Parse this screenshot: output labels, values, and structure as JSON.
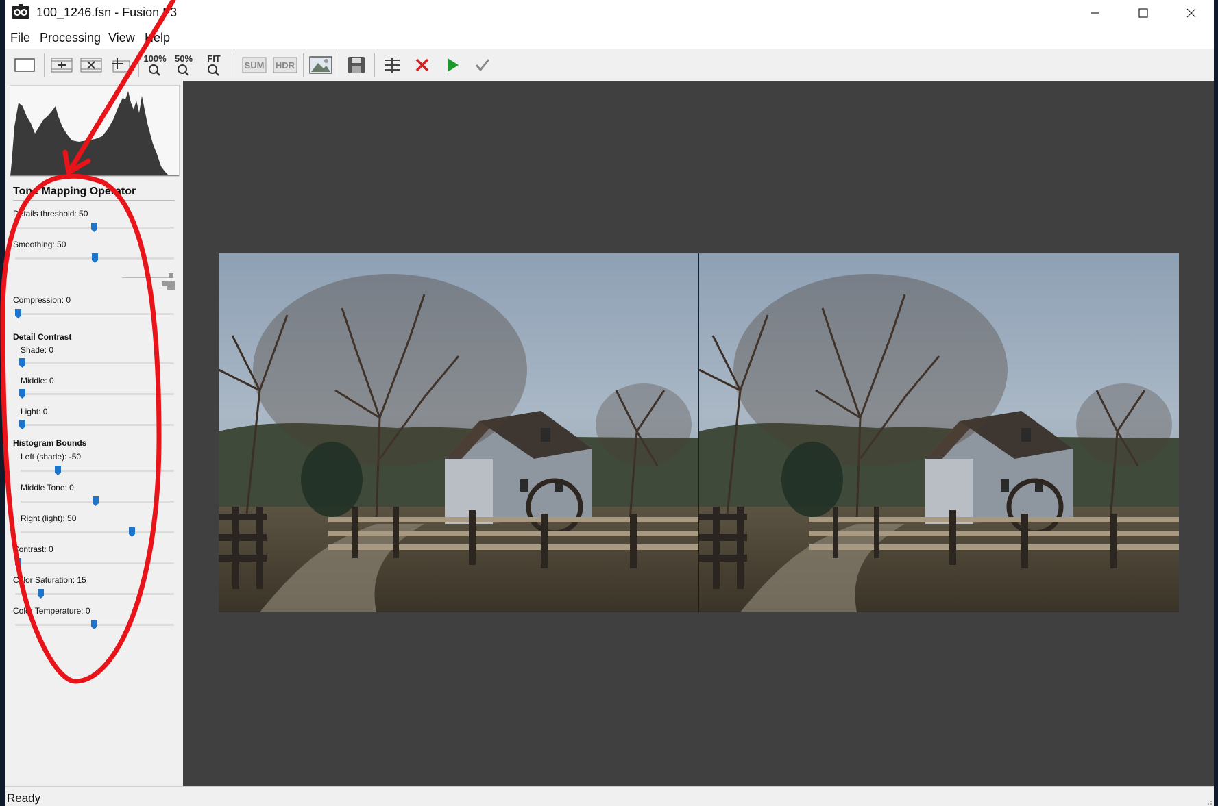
{
  "window": {
    "title": "100_1246.fsn - Fusion F3"
  },
  "menu": [
    "File",
    "Processing",
    "View",
    "Help"
  ],
  "toolbar": {
    "zoom100": "100%",
    "zoom50": "50%",
    "fit": "FIT",
    "sum": "SUM",
    "hdr": "HDR"
  },
  "panel": {
    "title": "Tone Mapping Operator",
    "details_threshold": {
      "label": "Details threshold: 50",
      "value": 50
    },
    "smoothing": {
      "label": "Smoothing: 50",
      "value": 50
    },
    "compression": {
      "label": "Compression: 0",
      "value": 0
    },
    "detail_contrast": {
      "title": "Detail Contrast",
      "shade": {
        "label": "Shade: 0",
        "value": 0
      },
      "middle": {
        "label": "Middle: 0",
        "value": 0
      },
      "light": {
        "label": "Light: 0",
        "value": 0
      }
    },
    "histogram_bounds": {
      "title": "Histogram Bounds",
      "left": {
        "label": "Left (shade): -50",
        "value": -50
      },
      "middle": {
        "label": "Middle Tone: 0",
        "value": 0
      },
      "right": {
        "label": "Right (light): 50",
        "value": 50
      }
    },
    "contrast": {
      "label": "Contrast: 0",
      "value": 0
    },
    "color_saturation": {
      "label": "Color Saturation: 15",
      "value": 15
    },
    "color_temperature": {
      "label": "Color Temperature: 0",
      "value": 0
    }
  },
  "status": "Ready",
  "colors": {
    "accent": "#1e74c8",
    "annotation": "#e8141a",
    "viewer_bg": "#404040"
  }
}
